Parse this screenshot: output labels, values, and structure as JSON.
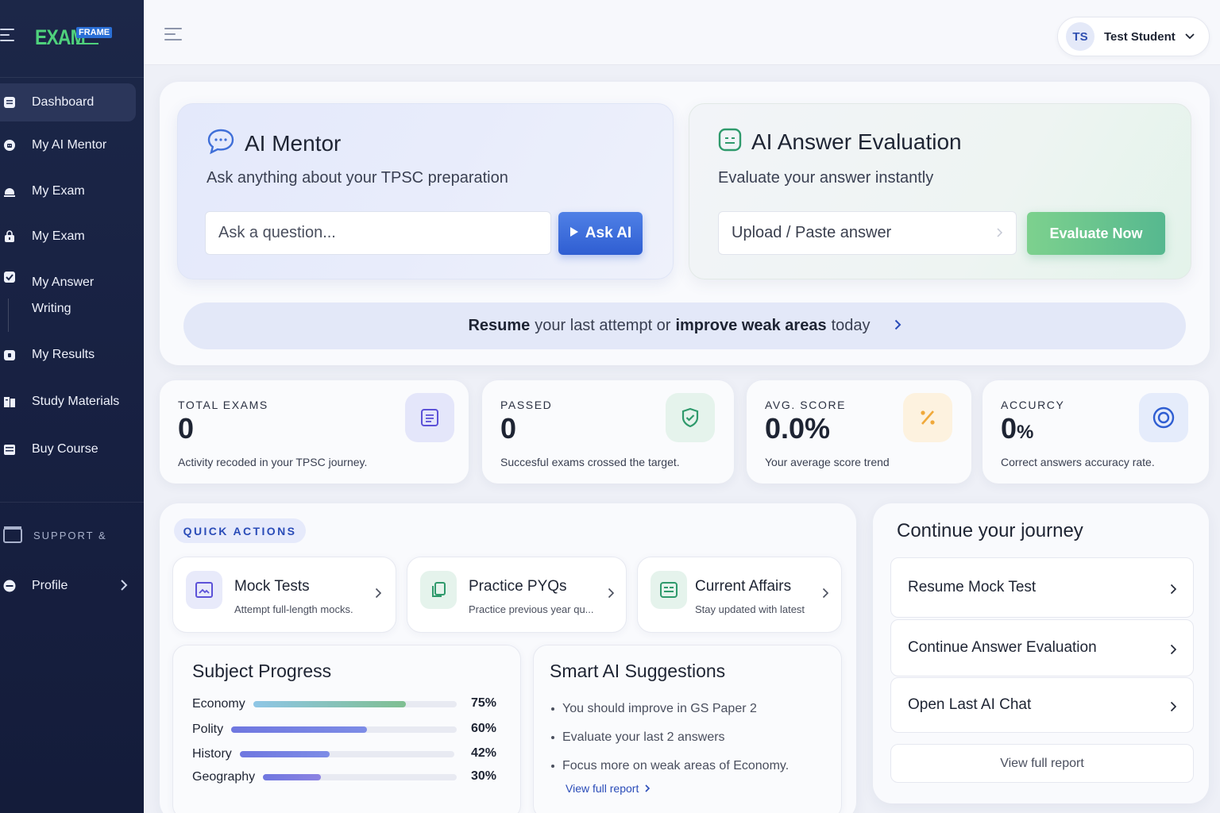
{
  "app": {
    "logo_text": "EXAM",
    "logo_tag": "FRAME"
  },
  "sidebar": {
    "items": [
      {
        "label": "Dashboard",
        "icon": "dashboard-icon"
      },
      {
        "label": "My AI Mentor",
        "icon": "robot-icon"
      },
      {
        "label": "My Exam",
        "icon": "exam-icon"
      },
      {
        "label": "My Exam",
        "icon": "lock-icon"
      },
      {
        "label": "My Answer",
        "label2": "Writing",
        "icon": "check-square-icon"
      },
      {
        "label": "My Results",
        "icon": "results-icon"
      },
      {
        "label": "Study Materials",
        "icon": "book-icon"
      },
      {
        "label": "Buy Course",
        "icon": "cart-icon"
      }
    ],
    "support_label": "SUPPORT &",
    "profile_label": "Profile"
  },
  "header": {
    "user_initials": "TS",
    "user_name": "Test Student"
  },
  "hero": {
    "mentor": {
      "title": "AI Mentor",
      "subtitle": "Ask anything about your TPSC preparation",
      "placeholder": "Ask a question...",
      "button": "Ask AI"
    },
    "evaluation": {
      "title": "AI Answer Evaluation",
      "subtitle": "Evaluate your answer instantly",
      "upload_label": "Upload / Paste answer",
      "button": "Evaluate Now"
    },
    "resume": {
      "bold1": "Resume",
      "text1": "your last attempt or",
      "bold2": "improve weak areas",
      "text2": "today"
    }
  },
  "stats": [
    {
      "label": "TOTAL EXAMS",
      "value": "0",
      "desc": "Activity recoded in your TPSC journey."
    },
    {
      "label": "PASSED",
      "value": "0",
      "desc": "Succesful exams crossed the target."
    },
    {
      "label": "AVG. SCORE",
      "value": "0.0%",
      "desc": "Your average score trend"
    },
    {
      "label": "ACCURCY",
      "value": "0",
      "unit": "%",
      "desc": "Correct answers accuracy rate."
    }
  ],
  "quick_actions": {
    "badge": "QUICK ACTIONS",
    "cards": [
      {
        "title": "Mock Tests",
        "sub": "Attempt full-length mocks."
      },
      {
        "title": "Practice PYQs",
        "sub": "Practice previous year qu..."
      },
      {
        "title": "Current Affairs",
        "sub": "Stay updated with latest"
      }
    ]
  },
  "subject_progress": {
    "title": "Subject Progress",
    "subjects": [
      {
        "name": "Economy",
        "pct": 75,
        "label": "75%"
      },
      {
        "name": "Polity",
        "pct": 60,
        "label": "60%"
      },
      {
        "name": "History",
        "pct": 42,
        "label": "42%"
      },
      {
        "name": "Geography",
        "pct": 30,
        "label": "30%"
      }
    ]
  },
  "suggestions": {
    "title": "Smart AI Suggestions",
    "items": [
      "You should improve in GS Paper 2",
      "Evaluate your last 2 answers",
      "Focus more on weak areas of Economy."
    ],
    "link": "View full report"
  },
  "journey": {
    "title": "Continue your journey",
    "items": [
      "Resume Mock Test",
      "Continue Answer Evaluation",
      "Open Last AI Chat"
    ],
    "report": "View full report"
  },
  "colors": {
    "primary": "#2f5ed2",
    "success": "#56b88f",
    "sidebar": "#1c2748",
    "accent_orange": "#f0a93a"
  }
}
